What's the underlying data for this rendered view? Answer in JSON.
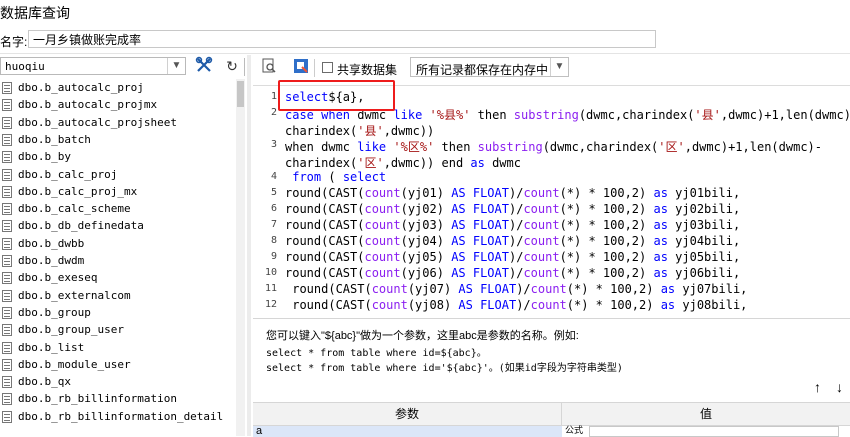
{
  "window": {
    "title": "数据库查询"
  },
  "name_field": {
    "label": "名字:",
    "value": "一月乡镇做账完成率"
  },
  "left_panel": {
    "db_select": {
      "value": "huoqiu"
    },
    "tree_items": [
      "dbo.b_autocalc_proj",
      "dbo.b_autocalc_projmx",
      "dbo.b_autocalc_projsheet",
      "dbo.b_batch",
      "dbo.b_by",
      "dbo.b_calc_proj",
      "dbo.b_calc_proj_mx",
      "dbo.b_calc_scheme",
      "dbo.b_db_definedata",
      "dbo.b_dwbb",
      "dbo.b_dwdm",
      "dbo.b_exeseq",
      "dbo.b_externalcom",
      "dbo.b_group",
      "dbo.b_group_user",
      "dbo.b_list",
      "dbo.b_module_user",
      "dbo.b_qx",
      "dbo.b_rb_billinformation",
      "dbo.b_rb_billinformation_detail"
    ]
  },
  "toolbar": {
    "share_label": "共享数据集",
    "share_checked": false,
    "mode_value": "所有记录都保存在内存中"
  },
  "editor": {
    "lines": [
      {
        "n": "1",
        "tokens": [
          [
            "kw",
            "select"
          ],
          [
            "",
            "${a},"
          ]
        ]
      },
      {
        "n": "2",
        "tokens": [
          [
            "kw",
            "case when"
          ],
          [
            "",
            " dwmc "
          ],
          [
            "kw",
            "like"
          ],
          [
            "",
            " "
          ],
          [
            "st",
            "'%县%'"
          ],
          [
            "",
            " then "
          ],
          [
            "fn",
            "substring"
          ],
          [
            "",
            "(dwmc,charindex("
          ],
          [
            "st",
            "'县'"
          ],
          [
            "",
            ",dwmc)+1,len(dwmc)-"
          ]
        ]
      },
      {
        "n": "",
        "tokens": [
          [
            "",
            "charindex("
          ],
          [
            "st",
            "'县'"
          ],
          [
            "",
            ",dwmc))"
          ]
        ]
      },
      {
        "n": "3",
        "tokens": [
          [
            "",
            "when dwmc "
          ],
          [
            "kw",
            "like"
          ],
          [
            "",
            " "
          ],
          [
            "st",
            "'%区%'"
          ],
          [
            "",
            " then "
          ],
          [
            "fn",
            "substring"
          ],
          [
            "",
            "(dwmc,charindex("
          ],
          [
            "st",
            "'区'"
          ],
          [
            "",
            ",dwmc)+1,len(dwmc)-"
          ]
        ]
      },
      {
        "n": "",
        "tokens": [
          [
            "",
            "charindex("
          ],
          [
            "st",
            "'区'"
          ],
          [
            "",
            ",dwmc)) end "
          ],
          [
            "kw",
            "as"
          ],
          [
            "",
            " dwmc"
          ]
        ]
      },
      {
        "n": "4",
        "tokens": [
          [
            "kw",
            " from"
          ],
          [
            "",
            " ( "
          ],
          [
            "kw",
            "select"
          ]
        ]
      },
      {
        "n": "5",
        "tokens": [
          [
            "",
            "round(CAST("
          ],
          [
            "fn",
            "count"
          ],
          [
            "",
            "(yj01) "
          ],
          [
            "kw",
            "AS FLOAT"
          ],
          [
            "",
            ")/"
          ],
          [
            "fn",
            "count"
          ],
          [
            "",
            "(*) * 100,2) "
          ],
          [
            "kw",
            "as"
          ],
          [
            "",
            " yj01bili,"
          ]
        ]
      },
      {
        "n": "6",
        "tokens": [
          [
            "",
            "round(CAST("
          ],
          [
            "fn",
            "count"
          ],
          [
            "",
            "(yj02) "
          ],
          [
            "kw",
            "AS FLOAT"
          ],
          [
            "",
            ")/"
          ],
          [
            "fn",
            "count"
          ],
          [
            "",
            "(*) * 100,2) "
          ],
          [
            "kw",
            "as"
          ],
          [
            "",
            " yj02bili,"
          ]
        ]
      },
      {
        "n": "7",
        "tokens": [
          [
            "",
            "round(CAST("
          ],
          [
            "fn",
            "count"
          ],
          [
            "",
            "(yj03) "
          ],
          [
            "kw",
            "AS FLOAT"
          ],
          [
            "",
            ")/"
          ],
          [
            "fn",
            "count"
          ],
          [
            "",
            "(*) * 100,2) "
          ],
          [
            "kw",
            "as"
          ],
          [
            "",
            " yj03bili,"
          ]
        ]
      },
      {
        "n": "8",
        "tokens": [
          [
            "",
            "round(CAST("
          ],
          [
            "fn",
            "count"
          ],
          [
            "",
            "(yj04) "
          ],
          [
            "kw",
            "AS FLOAT"
          ],
          [
            "",
            ")/"
          ],
          [
            "fn",
            "count"
          ],
          [
            "",
            "(*) * 100,2) "
          ],
          [
            "kw",
            "as"
          ],
          [
            "",
            " yj04bili,"
          ]
        ]
      },
      {
        "n": "9",
        "tokens": [
          [
            "",
            "round(CAST("
          ],
          [
            "fn",
            "count"
          ],
          [
            "",
            "(yj05) "
          ],
          [
            "kw",
            "AS FLOAT"
          ],
          [
            "",
            ")/"
          ],
          [
            "fn",
            "count"
          ],
          [
            "",
            "(*) * 100,2) "
          ],
          [
            "kw",
            "as"
          ],
          [
            "",
            " yj05bili,"
          ]
        ]
      },
      {
        "n": "10",
        "tokens": [
          [
            "",
            "round(CAST("
          ],
          [
            "fn",
            "count"
          ],
          [
            "",
            "(yj06) "
          ],
          [
            "kw",
            "AS FLOAT"
          ],
          [
            "",
            ")/"
          ],
          [
            "fn",
            "count"
          ],
          [
            "",
            "(*) * 100,2) "
          ],
          [
            "kw",
            "as"
          ],
          [
            "",
            " yj06bili,"
          ]
        ]
      },
      {
        "n": "11",
        "tokens": [
          [
            "",
            ""
          ],
          [
            "",
            ""
          ],
          [
            "",
            " round(CAST("
          ],
          [
            "fn",
            "count"
          ],
          [
            "",
            "(yj07) "
          ],
          [
            "kw",
            "AS FLOAT"
          ],
          [
            "",
            ")/"
          ],
          [
            "fn",
            "count"
          ],
          [
            "",
            "(*) * 100,2) "
          ],
          [
            "kw",
            "as"
          ],
          [
            "",
            " yj07bili,"
          ]
        ]
      },
      {
        "n": "12",
        "tokens": [
          [
            "",
            " round(CAST("
          ],
          [
            "fn",
            "count"
          ],
          [
            "",
            "(yj08) "
          ],
          [
            "kw",
            "AS FLOAT"
          ],
          [
            "",
            ")/"
          ],
          [
            "fn",
            "count"
          ],
          [
            "",
            "(*) * 100,2) "
          ],
          [
            "kw",
            "as"
          ],
          [
            "",
            " yj08bili,"
          ]
        ]
      }
    ]
  },
  "hint": {
    "line1": "您可以键入\"${abc}\"做为一个参数，这里abc是参数的名称。例如:",
    "line2": "select * from table where id=${abc}。",
    "line3": "select * from table where id='${abc}'。(如果id字段为字符串类型)"
  },
  "params_table": {
    "header_param": "参数",
    "header_value": "值",
    "row_param": "a",
    "row_side": "公式"
  },
  "colors": {
    "keyword": "#0000ff",
    "function": "#8b1ff0",
    "string": "#a51515",
    "annotation": "#ee1c1c",
    "selected_row": "#dbe6f8"
  }
}
